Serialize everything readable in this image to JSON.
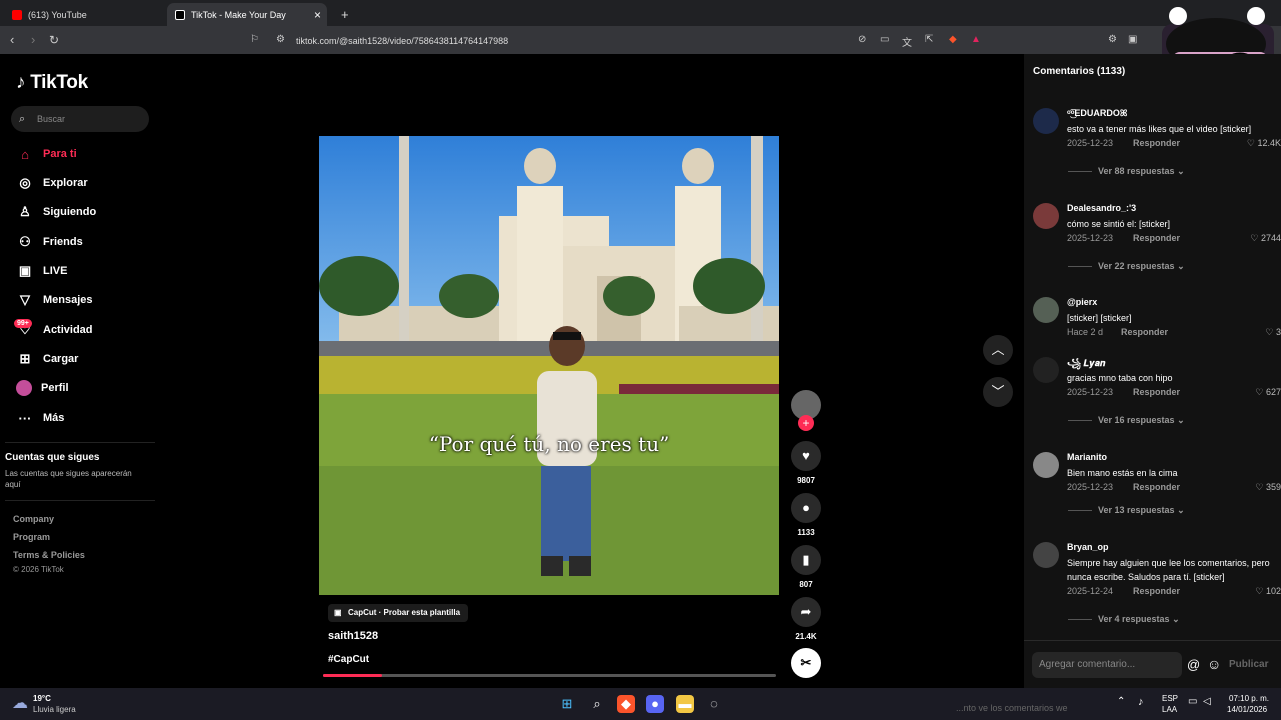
{
  "browser": {
    "tabs": [
      {
        "label": "(613) YouTube"
      },
      {
        "label": "TikTok - Make Your Day"
      }
    ],
    "new_tab": "+",
    "close_tab": "×",
    "url": "tiktok.com/@saith1528/video/7586438114764147988"
  },
  "sidebar": {
    "logo": "TikTok",
    "search_placeholder": "Buscar",
    "nav": [
      {
        "label": "Para ti",
        "icon": "home-icon"
      },
      {
        "label": "Explorar",
        "icon": "compass-icon"
      },
      {
        "label": "Siguiendo",
        "icon": "following-icon"
      },
      {
        "label": "Friends",
        "icon": "friends-icon"
      },
      {
        "label": "LIVE",
        "icon": "live-icon"
      },
      {
        "label": "Mensajes",
        "icon": "messages-icon"
      },
      {
        "label": "Actividad",
        "icon": "activity-icon",
        "badge": "99+"
      },
      {
        "label": "Cargar",
        "icon": "upload-icon"
      },
      {
        "label": "Perfil",
        "icon": "avatar"
      },
      {
        "label": "Más",
        "icon": "more-icon"
      }
    ],
    "following_title": "Cuentas que sigues",
    "following_desc": "Las cuentas que sigues aparecerán aquí",
    "footer": [
      "Company",
      "Program",
      "Terms & Policies"
    ],
    "copyright": "© 2026 TikTok"
  },
  "video": {
    "caption": "“Por qué tú, no eres tu”",
    "template_label": "CapCut · Probar esta plantilla",
    "username": "saith1528",
    "hashtag": "#CapCut",
    "progress": 0.13
  },
  "actions": {
    "likes": "9807",
    "comments": "1133",
    "saves": "807",
    "shares": "21.4K"
  },
  "comments": {
    "title": "Comentarios (1133)",
    "items": [
      {
        "user": "ᵒ͜͡ᵒEDUARDOꕤ",
        "text": "esto va a tener más likes que el video [sticker]",
        "date": "2025-12-23",
        "reply": "Responder",
        "likes": "12.4K",
        "more": "Ver 88 respuestas"
      },
      {
        "user": "Dealesandro_:'3",
        "text": "cómo se sintió el: [sticker]",
        "date": "2025-12-23",
        "reply": "Responder",
        "likes": "2744",
        "more": "Ver 22 respuestas"
      },
      {
        "user": "@pierx",
        "text": "[sticker] [sticker]",
        "date": "Hace 2 d",
        "reply": "Responder",
        "likes": "3",
        "more": ""
      },
      {
        "user": "꧁ 𝑳𝒚𝒂𝒏",
        "text": "gracias mno taba con hipo",
        "date": "2025-12-23",
        "reply": "Responder",
        "likes": "627",
        "more": "Ver 16 respuestas"
      },
      {
        "user": "Marianito",
        "text": "Bien mano estás en la cima",
        "date": "2025-12-23",
        "reply": "Responder",
        "likes": "359",
        "more": "Ver 13 respuestas"
      },
      {
        "user": "Bryan_op",
        "text": "Siempre hay alguien que lee los comentarios, pero nunca escribe. Saludos para tí. [sticker]",
        "date": "2025-12-24",
        "reply": "Responder",
        "likes": "102",
        "more": "Ver 4 respuestas"
      }
    ],
    "input_placeholder": "Agregar comentario...",
    "publish": "Publicar"
  },
  "taskbar": {
    "weather_temp": "19°C",
    "weather_desc": "Lluvia ligera",
    "lang": "ESP",
    "lang2": "LAA",
    "time": "07:10 p. m.",
    "date": "14/01/2026",
    "ticker": "...nto ve los comentarios we"
  },
  "colors": {
    "accent": "#fe2c55",
    "panel": "#121212"
  }
}
